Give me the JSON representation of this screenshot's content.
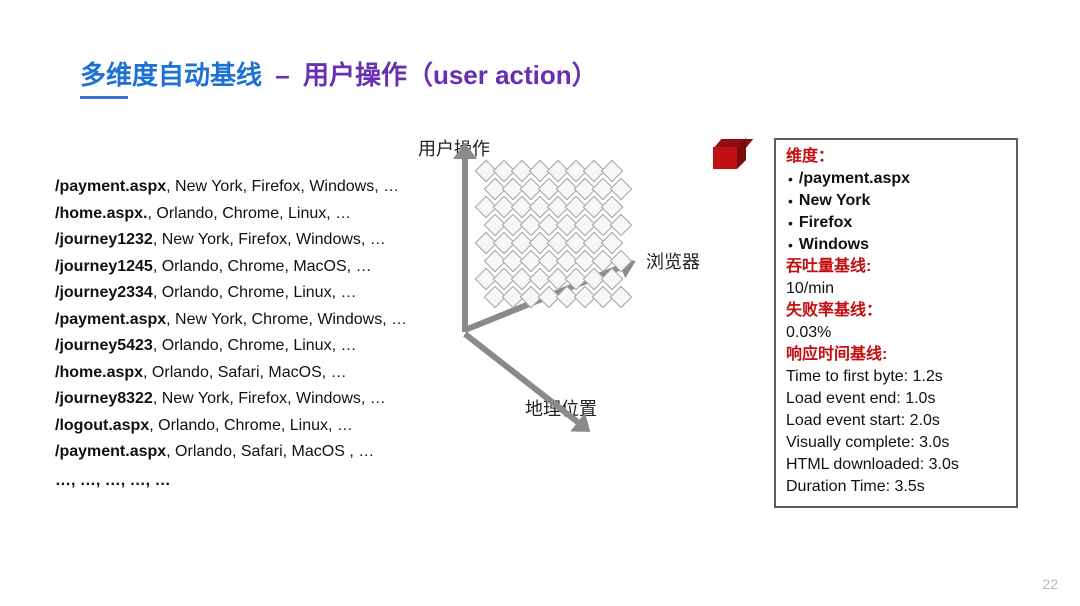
{
  "title": {
    "blue": "多维度自动基线",
    "dash": "–",
    "purple": "用户操作（user action）"
  },
  "list": {
    "rows": [
      {
        "bold": "/payment.aspx",
        "rest": ", New York, Firefox, Windows, …"
      },
      {
        "bold": "/home.aspx.",
        "rest": ", Orlando, Chrome, Linux, …"
      },
      {
        "bold": "/journey1232",
        "rest": ", New York, Firefox, Windows, …"
      },
      {
        "bold": "/journey1245",
        "rest": ", Orlando, Chrome, MacOS, …"
      },
      {
        "bold": "/journey2334",
        "rest": ", Orlando, Chrome, Linux, …"
      },
      {
        "bold": "/payment.aspx",
        "rest": ", New York, Chrome, Windows, …"
      },
      {
        "bold": "/journey5423",
        "rest": ", Orlando, Chrome, Linux, …"
      },
      {
        "bold": "/home.aspx",
        "rest": ", Orlando, Safari, MacOS, …"
      },
      {
        "bold": "/journey8322",
        "rest": ", New York, Firefox, Windows, …"
      },
      {
        "bold": "/logout.aspx",
        "rest": ", Orlando, Chrome, Linux, …"
      },
      {
        "bold": "/payment.aspx",
        "rest": ", Orlando, Safari, MacOS , …"
      }
    ],
    "ellipsis": "…, …, …, …, …"
  },
  "diagram": {
    "user_action": "用户操作",
    "browser": "浏览器",
    "geo": "地理位置"
  },
  "details": {
    "dim_label": "维度：",
    "dims": [
      "/payment.aspx",
      "New York",
      "Firefox",
      "Windows"
    ],
    "throughput_label": "吞吐量基线:",
    "throughput_value": "10/min",
    "failure_label": "失败率基线：",
    "failure_value": "0.03%",
    "response_label": "响应时间基线:",
    "response_lines": [
      "Time to first byte: 1.2s",
      "Load event end: 1.0s",
      "Load event start: 2.0s",
      "Visually complete: 3.0s",
      "HTML downloaded: 3.0s",
      "Duration Time: 3.5s"
    ]
  },
  "page_number": "22"
}
